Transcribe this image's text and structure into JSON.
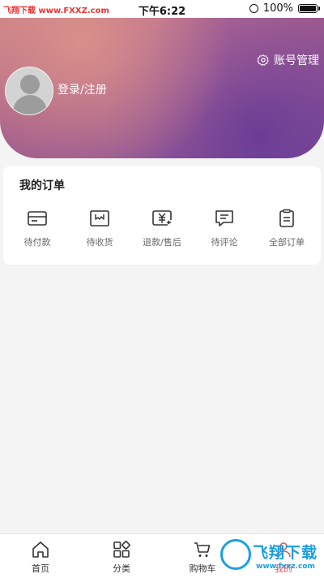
{
  "status_bar": {
    "left_label": "飞翔下载 www.FXXZ.com",
    "time": "下午6:22",
    "battery": "100%"
  },
  "header": {
    "settings_label": "账号管理",
    "login_label": "登录/注册"
  },
  "orders": {
    "title": "我的订单",
    "items": [
      {
        "label": "待付款",
        "icon": "wallet-icon"
      },
      {
        "label": "待收货",
        "icon": "delivery-box-icon"
      },
      {
        "label": "退款/售后",
        "icon": "refund-icon"
      },
      {
        "label": "待评论",
        "icon": "comment-icon"
      },
      {
        "label": "全部订单",
        "icon": "clipboard-icon"
      }
    ]
  },
  "tabbar": {
    "items": [
      {
        "label": "首页",
        "icon": "home-icon"
      },
      {
        "label": "分类",
        "icon": "category-icon"
      },
      {
        "label": "购物车",
        "icon": "cart-icon"
      },
      {
        "label": "我的",
        "icon": "user-icon"
      }
    ]
  },
  "watermark": {
    "text": "飞翔下载",
    "url": "www.fxxz.com"
  },
  "colors": {
    "hero_gradient": [
      "#d98f8a",
      "#a35d8c",
      "#7b4a9c"
    ],
    "watermark": "#1aa0e0",
    "background": "#f4f4f4"
  }
}
